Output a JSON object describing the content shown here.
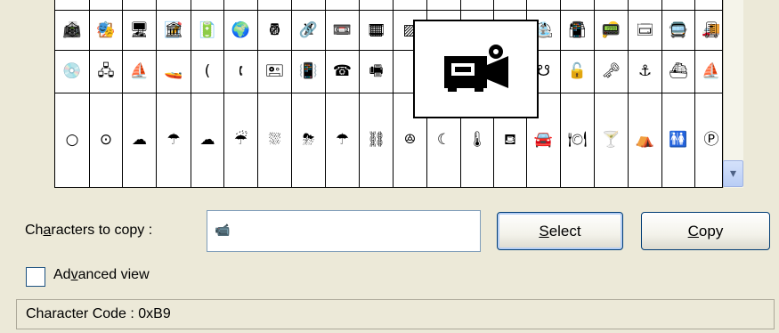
{
  "grid": {
    "rows": [
      [
        "📠",
        "📋",
        "🖥",
        "📝",
        "📄",
        "🗎",
        "🖩",
        "♜",
        "⏏",
        "▦",
        "▨",
        "",
        "",
        "",
        "⛱",
        "🗃",
        "🔑",
        "🗔",
        "🚍",
        "🚚"
      ],
      [
        "🕸",
        "🎭",
        "♫",
        "🏛",
        "🔋",
        "🌍",
        "⊘",
        "🔗",
        "📼",
        "🎞",
        "",
        "",
        "",
        "",
        "⛲",
        "📱",
        "📟",
        "▭",
        "🖵",
        "🎚"
      ],
      [
        "💿",
        "🖧",
        "⛵",
        "🚤",
        "(",
        "🕻",
        "🖭",
        "📳",
        "☎",
        "🖷",
        "",
        "",
        "",
        "",
        "☋",
        "🔓",
        "🗝",
        "⚓",
        "⛴",
        "⛵"
      ],
      [
        "○",
        "⊙",
        "☁",
        "☂",
        "☁",
        "☔",
        "⛆",
        "⛈",
        "☂",
        "⛓",
        "ꔮ",
        "☾",
        "🌡",
        "⛾",
        "🚘",
        "🍽",
        "🍸",
        "⛺",
        "🚻",
        "Ⓟ"
      ]
    ],
    "preview_icon": "video-camera-icon"
  },
  "scrollbar": {
    "down_arrow": "▾"
  },
  "chars_to_copy": {
    "label_prefix": "Ch",
    "label_accel": "a",
    "label_suffix": "racters to copy :",
    "value": "📹"
  },
  "buttons": {
    "select_accel": "S",
    "select_rest": "elect",
    "copy_accel": "C",
    "copy_rest": "opy"
  },
  "advanced_view": {
    "label_prefix": "Ad",
    "label_accel": "v",
    "label_suffix": "anced view",
    "checked": false
  },
  "status": {
    "text": "Character Code : 0xB9"
  },
  "colors": {
    "window_bg": "#ece9d8",
    "button_border": "#003c74",
    "input_border": "#7f9db9"
  }
}
